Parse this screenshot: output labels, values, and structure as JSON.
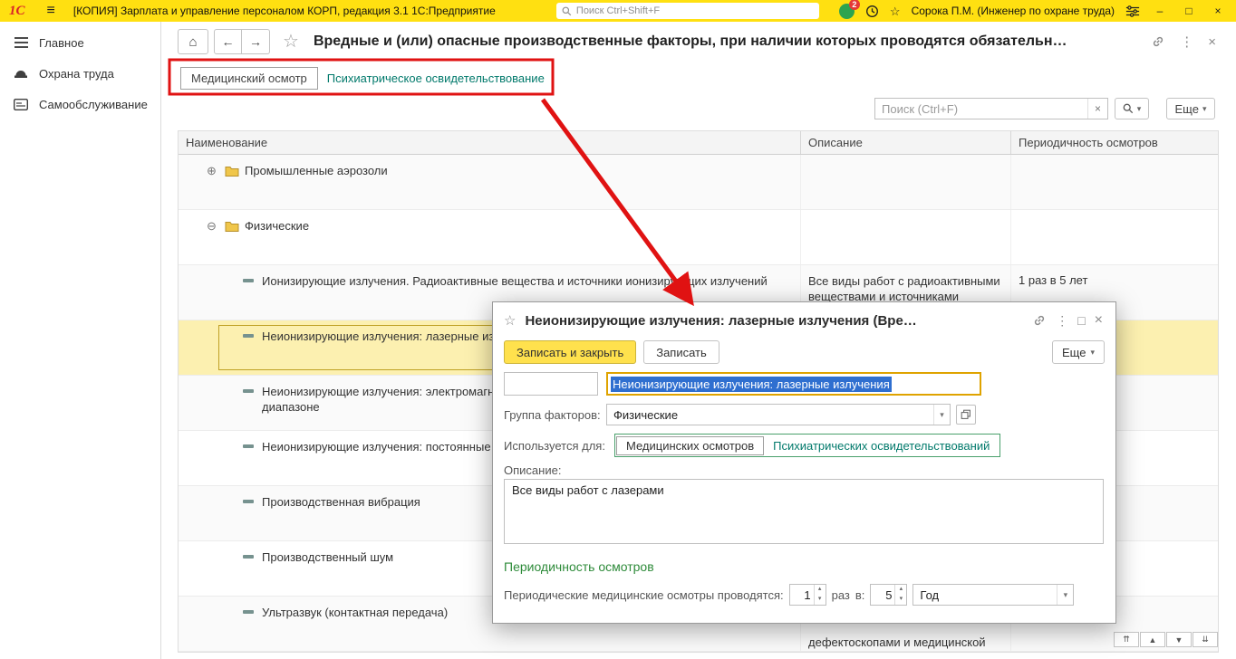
{
  "colors": {
    "titlebar_yellow": "#ffe011",
    "annotation_red": "#e01212",
    "selected_row_yellow": "#fcf0b0",
    "primary_button_yellow": "#ffe14d",
    "switch_link_green": "#00796b",
    "section_header_green": "#2e8b3a",
    "name_input_border": "#dfa300",
    "selection_blue": "#2f6fd0"
  },
  "icons": {
    "menu": "≡",
    "home": "⌂",
    "back": "←",
    "forward": "→",
    "favorite_star": "☆",
    "more_vertical": "⋮",
    "close": "×",
    "minimize": "–",
    "maximize": "□",
    "dropdown_arrow": "▾",
    "spin_up": "▴",
    "spin_down": "▾",
    "expander_closed": "⊕",
    "expander_open": "⊖",
    "clear": "×",
    "scroll_top": "⇈",
    "scroll_up": "▲",
    "scroll_down": "▼",
    "scroll_bottom": "⇊"
  },
  "titlebar": {
    "logo": "1С",
    "app_title": "[КОПИЯ] Зарплата и управление персоналом КОРП, редакция 3.1 1С:Предприятие",
    "search_placeholder": "Поиск Ctrl+Shift+F",
    "notifications_badge": "2",
    "user_name": "Сорока П.М. (Инженер по охране труда)"
  },
  "sidebar": {
    "items": [
      {
        "label": "Главное"
      },
      {
        "label": "Охрана труда"
      },
      {
        "label": "Самообслуживание"
      }
    ]
  },
  "listform": {
    "title": "Вредные и (или) опасные производственные факторы, при наличии которых проводятся обязательн…",
    "view_switch": [
      {
        "label": "Медицинский осмотр",
        "selected": true
      },
      {
        "label": "Психиатрическое освидетельствование",
        "selected": false
      }
    ],
    "search_placeholder": "Поиск (Ctrl+F)",
    "more_button": "Еще",
    "table": {
      "columns": [
        "Наименование",
        "Описание",
        "Периодичность осмотров"
      ],
      "rows": [
        {
          "kind": "group",
          "expanded": false,
          "name": "Промышленные аэрозоли"
        },
        {
          "kind": "group",
          "expanded": true,
          "name": "Физические"
        },
        {
          "kind": "item",
          "name": "Ионизирующие излучения. Радиоактивные вещества и источники ионизирующих излучений",
          "description": "Все виды работ с радиоактивными веществами и источниками",
          "periodicity": "1 раз в 5 лет"
        },
        {
          "kind": "item",
          "selected": true,
          "name": "Неионизирующие излучения: лазерные излучения"
        },
        {
          "kind": "item",
          "name": "Неионизирующие излучения: электромагн",
          "name_line2": "диапазоне"
        },
        {
          "kind": "item",
          "name": "Неионизирующие излучения: постоянные"
        },
        {
          "kind": "item",
          "name": "Производственная вибрация"
        },
        {
          "kind": "item",
          "name": "Производственный шум"
        },
        {
          "kind": "item",
          "name": "Ультразвук (контактная передача)",
          "description_fragment": "дефектоскопами и медицинской"
        }
      ]
    }
  },
  "dialog": {
    "title": "Неионизирующие излучения: лазерные излучения (Вре…",
    "save_close_button": "Записать и закрыть",
    "save_button": "Записать",
    "more_button": "Еще",
    "code_value": "",
    "name_value": "Неионизирующие излучения: лазерные излучения",
    "group_label": "Группа факторов:",
    "group_value": "Физические",
    "used_for_label": "Используется для:",
    "used_for_options": [
      {
        "label": "Медицинских осмотров",
        "selected": true
      },
      {
        "label": "Психиатрических освидетельствований",
        "selected": false
      }
    ],
    "description_label": "Описание:",
    "description_value": "Все виды работ с лазерами",
    "periodicity_header": "Периодичность осмотров",
    "periodicity_label": "Периодические медицинские осмотры проводятся:",
    "count_value": "1",
    "count_unit_label": "раз",
    "in_label": "в:",
    "interval_value": "5",
    "interval_unit_value": "Год"
  }
}
